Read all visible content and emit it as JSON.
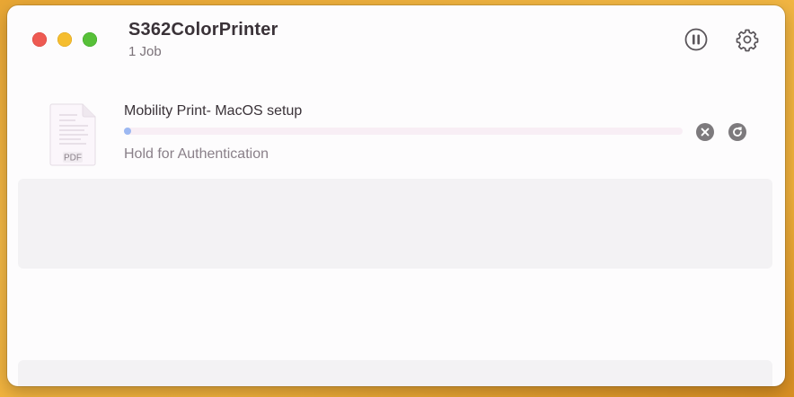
{
  "window": {
    "title": "S362ColorPrinter",
    "subtitle": "1 Job"
  },
  "toolbar": {
    "pause_icon": "pause-circle-icon",
    "settings_icon": "gear-icon"
  },
  "job": {
    "name": "Mobility Print- MacOS setup",
    "status": "Hold for Authentication",
    "file_type": "PDF",
    "progress": 0.01,
    "cancel_icon": "cancel-x-icon",
    "retry_icon": "retry-icon"
  },
  "colors": {
    "close": "#ee5a52",
    "minimize": "#f5bd2f",
    "maximize": "#57c038",
    "progress_fill": "#9cb8f2",
    "progress_track": "#f8eef5"
  }
}
